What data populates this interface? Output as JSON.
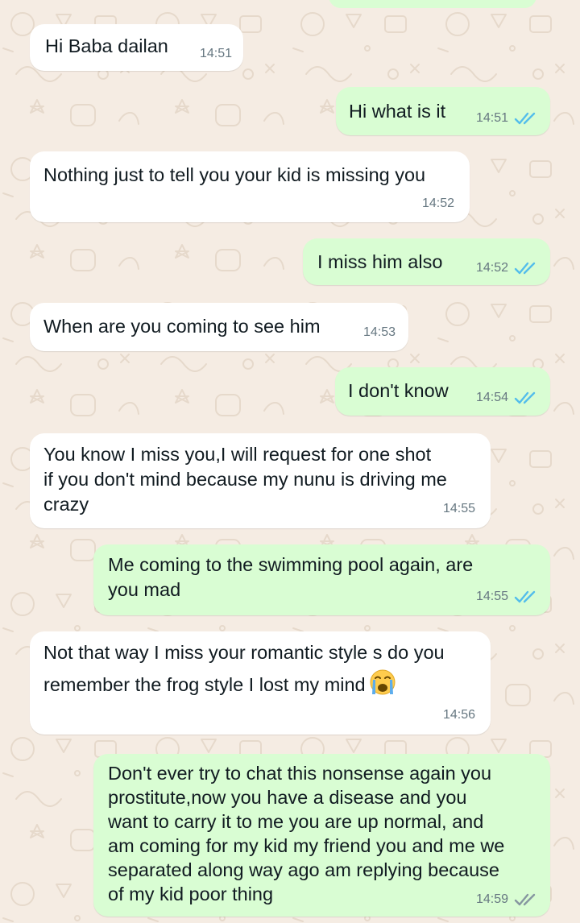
{
  "colors": {
    "wallpaper": "#f5ece3",
    "incoming_bubble": "#ffffff",
    "outgoing_bubble": "#d9fdd3",
    "read_ticks": "#53bdeb",
    "delivered_ticks": "#8696a0",
    "time_text": "#667781"
  },
  "messages": [
    {
      "direction": "in",
      "lines": [
        "Hi Baba dailan"
      ],
      "time": "14:51"
    },
    {
      "direction": "out",
      "lines": [
        "Hi what is it"
      ],
      "time": "14:51",
      "status": "read"
    },
    {
      "direction": "in",
      "lines": [
        "Nothing just to tell you your kid is missing you"
      ],
      "time": "14:52"
    },
    {
      "direction": "out",
      "lines": [
        "I miss him also"
      ],
      "time": "14:52",
      "status": "read"
    },
    {
      "direction": "in",
      "lines": [
        "When are you coming to see him"
      ],
      "time": "14:53"
    },
    {
      "direction": "out",
      "lines": [
        "I don't know"
      ],
      "time": "14:54",
      "status": "read"
    },
    {
      "direction": "in",
      "lines": [
        "You know I miss you,I will request for one shot",
        "if you don't mind because my nunu is driving me",
        "crazy"
      ],
      "time": "14:55"
    },
    {
      "direction": "out",
      "lines": [
        "Me coming to the swimming pool again, are",
        "you mad"
      ],
      "time": "14:55",
      "status": "read"
    },
    {
      "direction": "in",
      "lines": [
        "Not that way I miss your romantic style s do you",
        "remember the frog style I lost my mind"
      ],
      "time": "14:56",
      "emoji": "loudly-crying-face-icon"
    },
    {
      "direction": "out",
      "lines": [
        "Don't ever try to chat this nonsense again you",
        "prostitute,now you have a disease and you",
        "want to carry it to me you are up normal, and",
        "am coming for my kid my friend you and me we",
        "separated along way ago am replying because",
        "of my kid poor thing"
      ],
      "time": "14:59",
      "status": "delivered"
    }
  ]
}
